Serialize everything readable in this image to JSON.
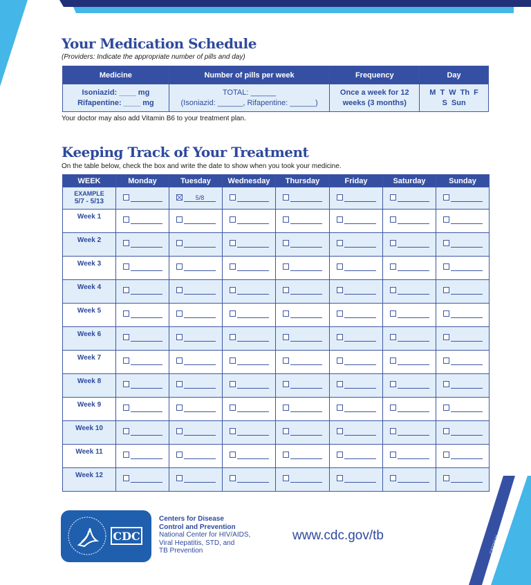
{
  "colors": {
    "navy": "#22307a",
    "brand_blue": "#3550a3",
    "light_blue": "#45b6e8",
    "cell_tint": "#e1eef9",
    "text_blue": "#2e4a9c"
  },
  "schedule": {
    "title": "Your Medication Schedule",
    "subtitle": "(Providers: Indicate the appropriate number of pills and day)",
    "headers": [
      "Medicine",
      "Number of pills per week",
      "Frequency",
      "Day"
    ],
    "row": {
      "medicine_line1": "Isoniazid: ____ mg",
      "medicine_line2": "Rifapentine: ____ mg",
      "pills_line1": "TOTAL: ______",
      "pills_line2": "(Isoniazid: ______, Rifapentine: ______)",
      "frequency_line1": "Once a week for 12",
      "frequency_line2": "weeks (3 months)",
      "day_line1": "M  T  W  Th  F",
      "day_line2": "S  Sun"
    },
    "note": "Your doctor may also add Vitamin B6 to your treatment plan."
  },
  "tracking": {
    "title": "Keeping Track of Your Treatment",
    "subtitle": "On the table below, check the box and write the date to show when you took your medicine.",
    "headers": [
      "WEEK",
      "Monday",
      "Tuesday",
      "Wednesday",
      "Thursday",
      "Friday",
      "Saturday",
      "Sunday"
    ],
    "example": {
      "label_line1": "EXAMPLE",
      "label_line2": "5/7 - 5/13",
      "checked_day": "Tuesday",
      "checked_date": "5/8"
    },
    "weeks": [
      "Week 1",
      "Week 2",
      "Week 3",
      "Week 4",
      "Week 5",
      "Week 6",
      "Week 7",
      "Week 8",
      "Week 9",
      "Week 10",
      "Week 11",
      "Week 12"
    ]
  },
  "footer": {
    "org_line1": "Centers for Disease",
    "org_line2": "Control and Prevention",
    "org_line3": "National Center for HIV/AIDS,",
    "org_line4": "Viral Hepatitis, STD, and",
    "org_line5": "TB Prevention",
    "logo_text": "CDC",
    "url": "www.cdc.gov/tb",
    "code": "CS326538"
  }
}
